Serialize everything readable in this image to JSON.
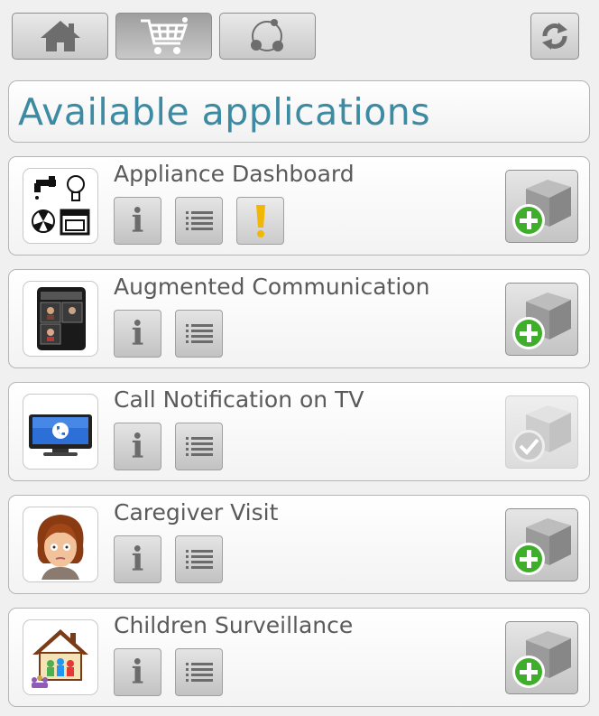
{
  "toolbar": {
    "buttons": [
      {
        "icon": "home-icon",
        "active": false
      },
      {
        "icon": "cart-icon",
        "active": true
      },
      {
        "icon": "network-icon",
        "active": false
      }
    ],
    "refresh_icon": "refresh-icon"
  },
  "page": {
    "title": "Available applications"
  },
  "apps": [
    {
      "name": "Appliance Dashboard",
      "icon": "appliance-icon",
      "warning": true,
      "status": "install"
    },
    {
      "name": "Augmented Communication",
      "icon": "communication-icon",
      "warning": false,
      "status": "install"
    },
    {
      "name": "Call Notification on TV",
      "icon": "tv-icon",
      "warning": false,
      "status": "installed"
    },
    {
      "name": "Caregiver Visit",
      "icon": "caregiver-icon",
      "warning": false,
      "status": "install"
    },
    {
      "name": "Children Surveillance",
      "icon": "house-icon",
      "warning": false,
      "status": "install"
    }
  ],
  "colors": {
    "title": "#3d8ba3",
    "install_green": "#3fae2a",
    "warning": "#f2b705"
  }
}
